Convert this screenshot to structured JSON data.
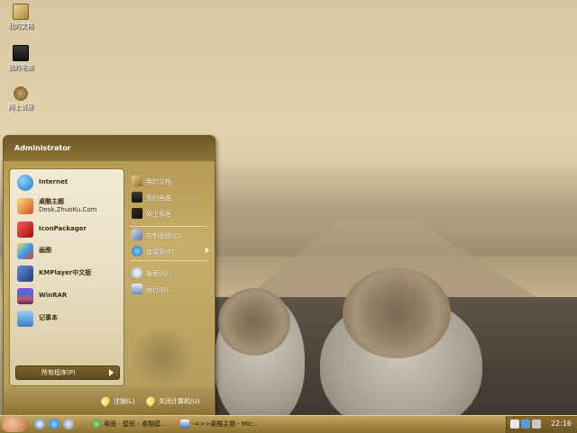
{
  "desktop": {
    "icons": [
      {
        "label": "我的文档",
        "icon": "my-documents-icon"
      },
      {
        "label": "我的电脑",
        "icon": "my-computer-icon"
      },
      {
        "label": "网上邻居",
        "icon": "network-places-icon"
      }
    ]
  },
  "start_menu": {
    "user": "Administrator",
    "programs": [
      {
        "label": "Internet",
        "icon": "internet-explorer-icon"
      },
      {
        "label": "桌酷主题",
        "sub": "Desk.ZhuoKu.Com",
        "icon": "zhuoku-theme-icon"
      },
      {
        "label": "IconPackager",
        "icon": "iconpackager-icon"
      },
      {
        "label": "画图",
        "icon": "paint-icon"
      },
      {
        "label": "KMPlayer中文版",
        "icon": "kmplayer-icon"
      },
      {
        "label": "WinRAR",
        "icon": "winrar-icon"
      },
      {
        "label": "记事本",
        "icon": "notepad-icon"
      }
    ],
    "all_programs": "所有程序(P)",
    "places": [
      {
        "label": "我的文档",
        "icon": "my-documents-icon"
      },
      {
        "label": "我的电脑",
        "icon": "my-computer-icon"
      },
      {
        "label": "网上邻居",
        "icon": "network-places-icon"
      }
    ],
    "system": [
      {
        "label": "控制面板(C)",
        "icon": "control-panel-icon"
      },
      {
        "label": "连接到(T)",
        "icon": "connect-to-icon"
      }
    ],
    "tools": [
      {
        "label": "搜索(S)",
        "icon": "search-icon"
      },
      {
        "label": "运行(R)...",
        "icon": "run-icon"
      }
    ],
    "logoff": "注销(L)",
    "shutdown": "关闭计算机(U)"
  },
  "taskbar": {
    "tasks": [
      {
        "label": "桌面 - 壁纸 - 桌酷壁...",
        "icon": "browser-icon"
      },
      {
        "label": "-=>>桌酷主题 - Mic...",
        "icon": "document-icon"
      }
    ],
    "clock": "22:16"
  },
  "colors": {
    "accent": "#a98b46",
    "menu": "#c8ae6a"
  }
}
